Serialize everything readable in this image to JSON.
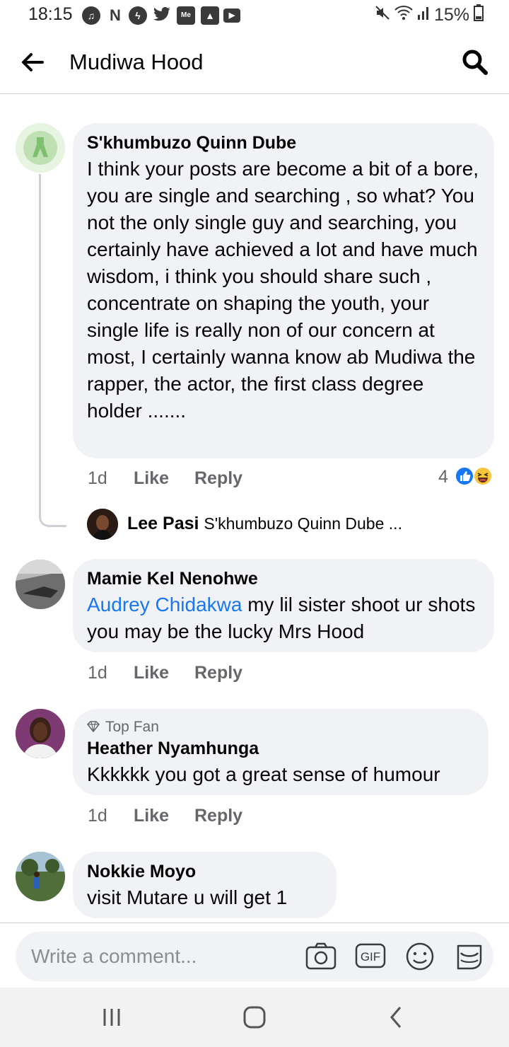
{
  "status_bar": {
    "time": "18:15",
    "battery": "15%",
    "left_icons": [
      "music-icon",
      "netflix-icon",
      "messenger-icon",
      "twitter-icon",
      "me-icon",
      "gallery-icon",
      "youtube-icon"
    ],
    "right_icons": [
      "mute-icon",
      "wifi-icon",
      "signal-icon",
      "battery-icon"
    ]
  },
  "header": {
    "title": "Mudiwa Hood"
  },
  "comments": [
    {
      "author": "S'khumbuzo Quinn Dube",
      "text": "I think your posts are become a bit of a bore, you are single and searching , so what? You not the only single guy and searching, you certainly have achieved a lot and have much wisdom, i think you should share such , concentrate on shaping the youth, your single life is really non of our concern at most, I certainly wanna know ab Mudiwa  the rapper, the actor, the first class degree holder .......",
      "time": "1d",
      "like": "Like",
      "reply": "Reply",
      "reactions_count": "4",
      "reply_preview": {
        "author": "Lee Pasi",
        "text": "S'khumbuzo Quinn Dube ..."
      }
    },
    {
      "author": "Mamie Kel Nenohwe",
      "mention": "Audrey Chidakwa",
      "text": " my lil sister shoot ur shots you may be the lucky Mrs Hood",
      "time": "1d",
      "like": "Like",
      "reply": "Reply"
    },
    {
      "badge": "Top Fan",
      "author": "Heather Nyamhunga",
      "text": "Kkkkkk you got a great sense of humour",
      "time": "1d",
      "like": "Like",
      "reply": "Reply"
    },
    {
      "author": "Nokkie Moyo",
      "text": "visit  Mutare u will get 1"
    }
  ],
  "composer": {
    "placeholder": "Write a comment..."
  },
  "colors": {
    "accent": "#1877f2",
    "bubble": "#f0f2f5",
    "meta": "#65676b"
  }
}
